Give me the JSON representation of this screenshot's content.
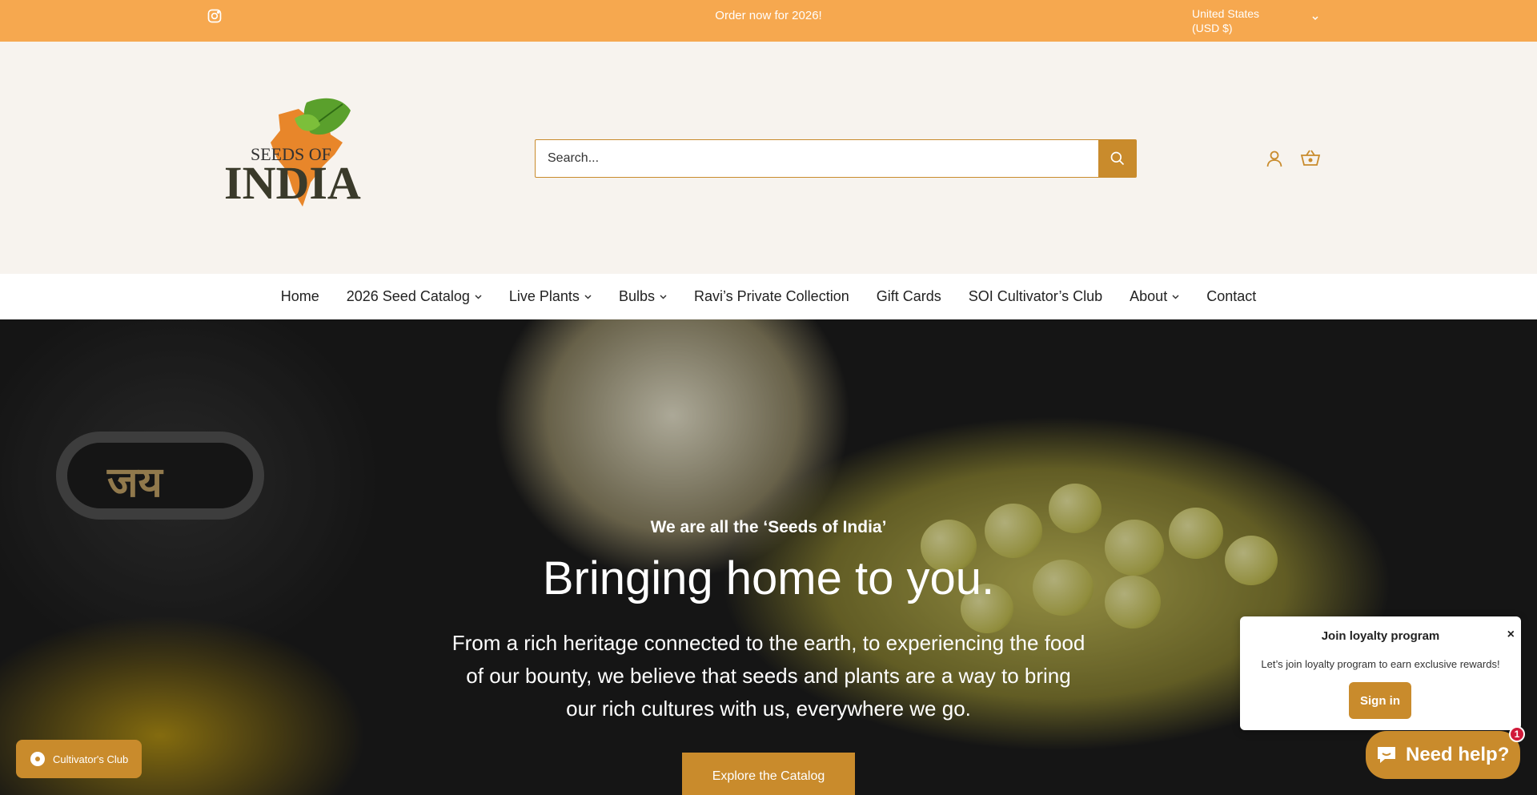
{
  "topbar": {
    "announcement": "Order now for 2026!",
    "country": "United States (USD $)",
    "social_icon": "instagram-icon"
  },
  "header": {
    "logo_text_top": "SEEDS OF",
    "logo_text_bottom": "INDIA",
    "search_placeholder": "Search...",
    "icons": [
      "search-icon",
      "account-icon",
      "cart-icon"
    ]
  },
  "nav": {
    "items": [
      {
        "label": "Home",
        "dropdown": false
      },
      {
        "label": "2026 Seed Catalog",
        "dropdown": true
      },
      {
        "label": "Live Plants",
        "dropdown": true
      },
      {
        "label": "Bulbs",
        "dropdown": true
      },
      {
        "label": "Ravi’s Private Collection",
        "dropdown": false
      },
      {
        "label": "Gift Cards",
        "dropdown": false
      },
      {
        "label": "SOI Cultivator’s Club",
        "dropdown": false
      },
      {
        "label": "About",
        "dropdown": true
      },
      {
        "label": "Contact",
        "dropdown": false
      }
    ]
  },
  "hero": {
    "sign_text": "जय",
    "subtitle": "We are all the ‘Seeds of India’",
    "title": "Bringing home to you.",
    "description": "From a rich heritage connected to the earth, to experiencing the food of our bounty, we believe that seeds and plants are a way to bring our rich cultures with us, everywhere we go.",
    "cta": "Explore the Catalog"
  },
  "loyalty": {
    "title": "Join loyalty program",
    "close": "×",
    "message": "Let’s join loyalty program to earn exclusive rewards!",
    "button": "Sign in"
  },
  "club": {
    "label": "Cultivator's Club"
  },
  "chat": {
    "label": "Need help?",
    "badge": "1"
  },
  "colors": {
    "topbar": "#f6a84f",
    "accent": "#c98b2c",
    "header_bg": "#f7f3ee",
    "badge": "#d11a3a"
  }
}
